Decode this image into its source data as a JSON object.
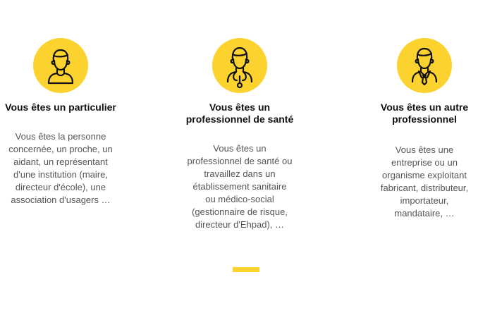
{
  "cards": [
    {
      "icon": "person-icon",
      "title": "Vous êtes un particulier",
      "description": "Vous êtes la personne concernée, un proche, un aidant, un représentant d'une institution (maire, directeur d'école), une association d'usagers …"
    },
    {
      "icon": "doctor-stethoscope-icon",
      "title": "Vous êtes un professionnel de santé",
      "description": "Vous êtes un professionnel de santé ou travaillez dans un établissement sanitaire ou médico-social (gestionnaire de risque, directeur d'Ehpad), …"
    },
    {
      "icon": "professional-tie-icon",
      "title": "Vous êtes un autre professionnel",
      "description": "Vous êtes une entreprise ou un organisme exploitant fabricant, distributeur, importateur, mandataire, …"
    }
  ],
  "colors": {
    "accent": "#fbd22e",
    "title": "#111111",
    "text": "#555555"
  }
}
